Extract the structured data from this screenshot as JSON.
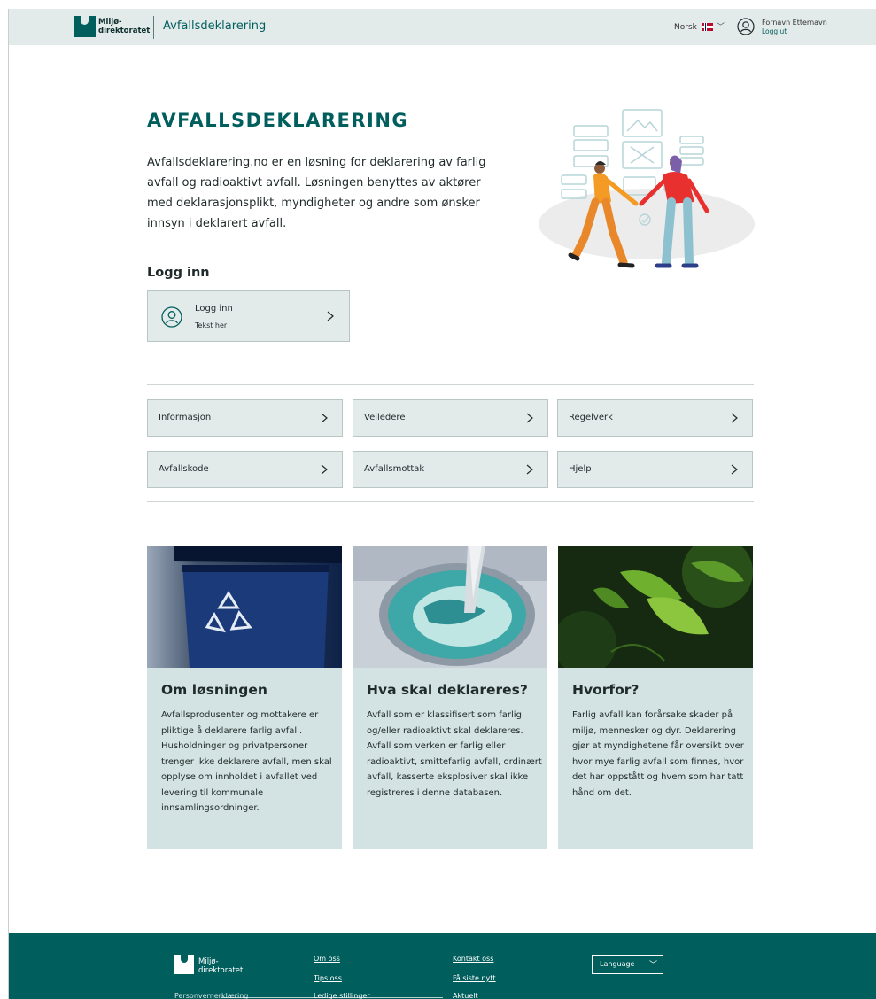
{
  "header": {
    "logo_text": "Miljø-\ndirektoratet",
    "app_title": "Avfallsdeklarering",
    "language": "Norsk",
    "user_name": "Fornavn Etternavn",
    "logout": "Logg ut"
  },
  "hero": {
    "title": "AVFALLSDEKLARERING",
    "text": "Avfallsdeklarering.no er en løsning for deklarering av farlig avfall og radioaktivt avfall. Løsningen benyttes av aktører med deklarasjonsplikt, myndigheter og andre som ønsker innsyn i deklarert avfall."
  },
  "login": {
    "heading": "Logg inn",
    "card_title": "Logg inn",
    "card_subtitle": "Tekst her"
  },
  "nav_cards": [
    {
      "label": "Informasjon"
    },
    {
      "label": "Veiledere"
    },
    {
      "label": "Regelverk"
    },
    {
      "label": "Avfallskode"
    },
    {
      "label": "Avfallsmottak"
    },
    {
      "label": "Hjelp"
    }
  ],
  "info_cards": [
    {
      "title": "Om løsningen",
      "text": "Avfallsprodusenter og mottakere er pliktige å deklarere farlig avfall. Husholdninger og privatpersoner trenger ikke deklarere avfall, men skal opplyse om innholdet i avfallet ved levering til kommunale innsamlingsordninger."
    },
    {
      "title": "Hva skal deklareres?",
      "text": "Avfall som er klassifisert som farlig og/eller radioaktivt skal deklareres.\nAvfall som verken er farlig eller radioaktivt, smittefarlig avfall, ordinært avfall, kasserte eksplosiver skal ikke registreres i denne databasen."
    },
    {
      "title": "Hvorfor?",
      "text": "Farlig avfall kan forårsake skader på miljø, mennesker og dyr. Deklarering gjør at myndighetene får oversikt over hvor mye farlig avfall som finnes, hvor det har oppstått og hvem som har tatt hånd om det."
    }
  ],
  "footer": {
    "logo_text": "Miljø-\ndirektoratet",
    "links": {
      "om_oss": "Om oss",
      "tips_oss": "Tips oss",
      "ledige_stillinger": "Ledige stillinger",
      "kontakt_oss": "Kontakt oss",
      "fa_siste_nytt": "Få siste nytt",
      "aktuelt": "Aktuelt",
      "personvern": "Personvernerklæring"
    },
    "language_select": "Language"
  },
  "colors": {
    "brand": "#005e5d",
    "card_bg": "#e3eaea",
    "info_bg": "#d3e2e2"
  },
  "icons": [
    "user-circle-icon",
    "chevron-right-icon",
    "chevron-down-icon",
    "norway-flag-icon",
    "recycle-icon"
  ]
}
